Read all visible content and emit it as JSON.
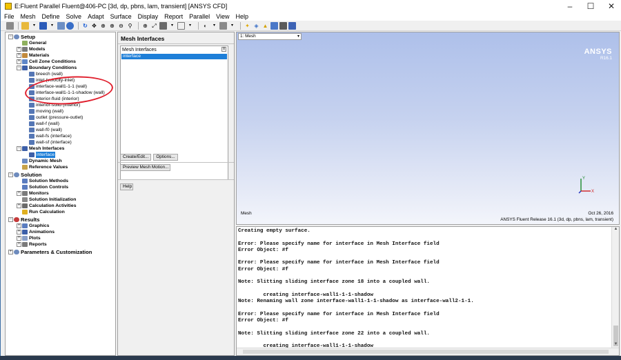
{
  "window": {
    "title": "E:Fluent Parallel Fluent@406-PC  [3d, dp, pbns, lam, transient] [ANSYS CFD]",
    "buttons": [
      "–",
      "☐",
      "✕"
    ]
  },
  "menu": [
    "File",
    "Mesh",
    "Define",
    "Solve",
    "Adapt",
    "Surface",
    "Display",
    "Report",
    "Parallel",
    "View",
    "Help"
  ],
  "tree": {
    "setup": "Setup",
    "general": "General",
    "models": "Models",
    "materials": "Materials",
    "cell_zone": "Cell Zone Conditions",
    "boundary": "Boundary Conditions",
    "boundaries": [
      "breech (wall)",
      "inlet (velocity-inlet)",
      "interface-wall1-1-1 (wall)",
      "interface-wall1-1-1-shadow (wall)",
      "interior-fluid (interior)",
      "interior-solid (interior)",
      "moving (wall)",
      "outlet (pressure-outlet)",
      "wall-f (wall)",
      "wall-f0 (wall)",
      "wall-fs (interface)",
      "wall-sf (interface)"
    ],
    "mesh_interfaces": "Mesh Interfaces",
    "interface_item": "interface",
    "dynamic_mesh": "Dynamic Mesh",
    "reference_values": "Reference Values",
    "solution": "Solution",
    "solution_methods": "Solution Methods",
    "solution_controls": "Solution Controls",
    "monitors": "Monitors",
    "solution_init": "Solution Initialization",
    "calc_activities": "Calculation Activities",
    "run_calc": "Run Calculation",
    "results": "Results",
    "graphics": "Graphics",
    "animations": "Animations",
    "plots": "Plots",
    "reports": "Reports",
    "params": "Parameters & Customization"
  },
  "task": {
    "title": "Mesh Interfaces",
    "list_header": "Mesh Interfaces",
    "list_items": [
      "interface"
    ],
    "create_edit": "Create/Edit...",
    "options": "Options...",
    "preview": "Preview Mesh Motion...",
    "help": "Help"
  },
  "graphics": {
    "view_select": "1: Mesh",
    "brand": "ANSYS",
    "version": "R16.1",
    "label": "Mesh",
    "date": "Oct 26, 2016",
    "release": "ANSYS Fluent Release 16.1 (3d, dp, pbns, lam, transient)",
    "axis_y": "Y",
    "axis_x": "X"
  },
  "console": [
    "Creating empty surface.",
    "",
    "Error: Please specify name for interface in Mesh Interface field",
    "Error Object: #f",
    "",
    "Error: Please specify name for interface in Mesh Interface field",
    "Error Object: #f",
    "",
    "Note: Slitting sliding interface zone 18 into a coupled wall.",
    "",
    "        creating interface-wall1-1-1-shadow",
    "Note: Renaming wall zone interface-wall1-1-1-shadow as interface-wall2-1-1.",
    "",
    "Error: Please specify name for interface in Mesh Interface field",
    "Error Object: #f",
    "",
    "Note: Slitting sliding interface zone 22 into a coupled wall.",
    "",
    "        creating interface-wall1-1-1-shadow"
  ]
}
